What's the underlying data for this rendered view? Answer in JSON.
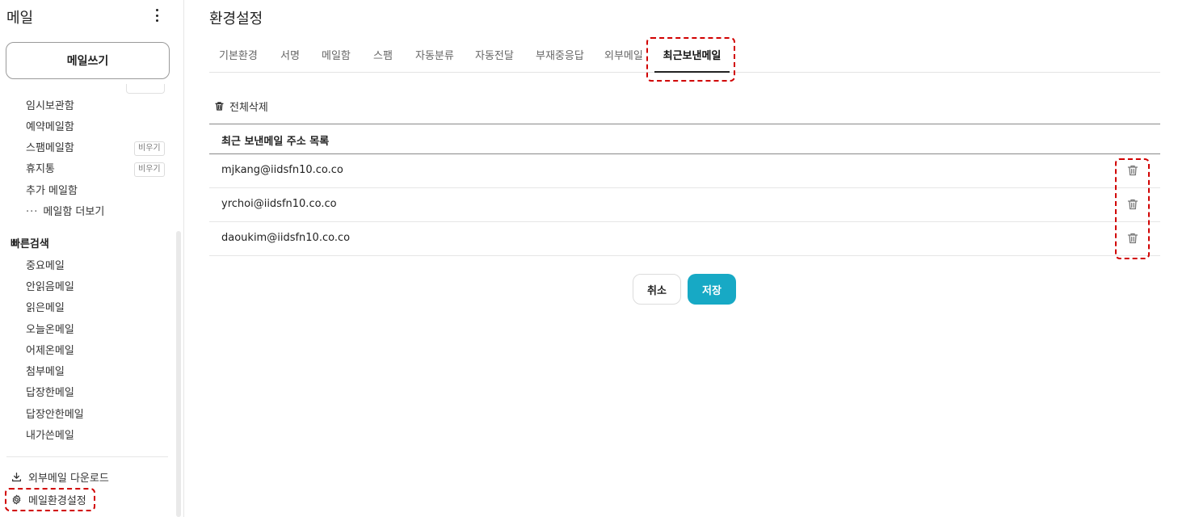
{
  "sidebar": {
    "title": "메일",
    "compose_label": "메일쓰기",
    "mailboxes": [
      {
        "label": "임시보관함",
        "badge": ""
      },
      {
        "label": "예약메일함",
        "badge": ""
      },
      {
        "label": "스팸메일함",
        "badge": "비우기"
      },
      {
        "label": "휴지통",
        "badge": "비우기"
      },
      {
        "label": "추가 메일함",
        "badge": ""
      }
    ],
    "more_label": "메일함 더보기",
    "more_icon": "ellipsis-icon",
    "quick_search": {
      "title": "빠른검색",
      "items": [
        "중요메일",
        "안읽음메일",
        "읽은메일",
        "오늘온메일",
        "어제온메일",
        "첨부메일",
        "답장한메일",
        "답장안한메일",
        "내가쓴메일"
      ]
    },
    "bottom_links": [
      {
        "label": "외부메일 다운로드",
        "icon": "download-icon"
      },
      {
        "label": "메일환경설정",
        "icon": "gear-icon"
      }
    ]
  },
  "main": {
    "title": "환경설정",
    "tabs": [
      {
        "label": "기본환경",
        "active": false
      },
      {
        "label": "서명",
        "active": false
      },
      {
        "label": "메일함",
        "active": false
      },
      {
        "label": "스팸",
        "active": false
      },
      {
        "label": "자동분류",
        "active": false
      },
      {
        "label": "자동전달",
        "active": false
      },
      {
        "label": "부재중응답",
        "active": false
      },
      {
        "label": "외부메일",
        "active": false
      },
      {
        "label": "최근보낸메일",
        "active": true
      }
    ],
    "delete_all_label": "전체삭제",
    "list_header": "최근 보낸메일 주소 목록",
    "addresses": [
      "mjkang@iidsfn10.co.co",
      "yrchoi@iidsfn10.co.co",
      "daoukim@iidsfn10.co.co"
    ],
    "cancel_label": "취소",
    "save_label": "저장"
  },
  "colors": {
    "accent": "#17a9c5",
    "highlight": "#d10000"
  }
}
